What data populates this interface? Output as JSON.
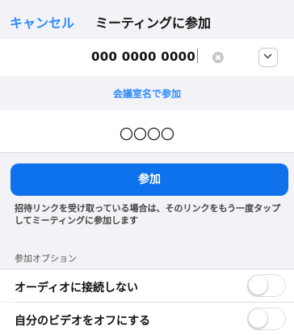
{
  "nav": {
    "cancel_label": "キャンセル",
    "title": "ミーティングに参加"
  },
  "meeting_id": {
    "value": "000 0000 0000",
    "clear_icon": "clear-icon",
    "dropdown_icon": "chevron-down-icon"
  },
  "join_by_room_name": "会議室名で参加",
  "display_name": {
    "value": "〇〇〇〇"
  },
  "join_button_label": "参加",
  "hint_text": "招待リンクを受け取っている場合は、そのリンクをもう一度タップしてミーティングに参加します",
  "options": {
    "section_label": "参加オプション",
    "items": [
      {
        "label": "オーディオに接続しない",
        "enabled": false
      },
      {
        "label": "自分のビデオをオフにする",
        "enabled": false
      }
    ]
  },
  "colors": {
    "accent": "#2d8cff",
    "button": "#0e72ed",
    "background": "#f2f2f7"
  }
}
